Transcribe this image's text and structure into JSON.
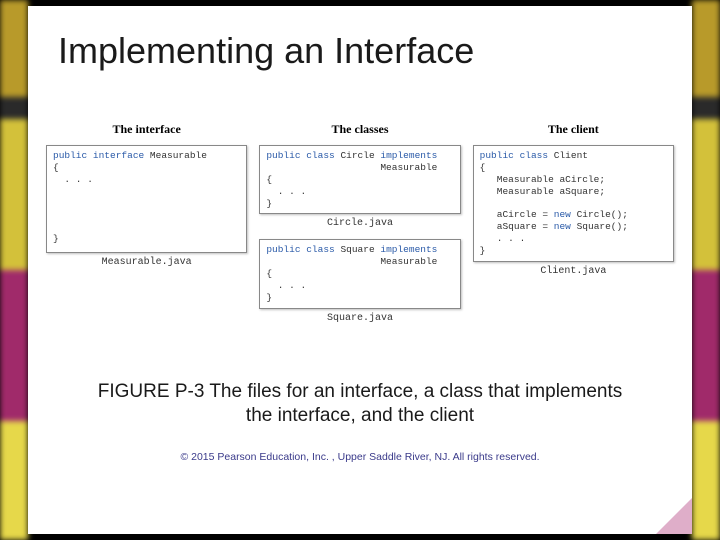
{
  "title": "Implementing an Interface",
  "columns": {
    "interface": {
      "header": "The interface",
      "box1": {
        "line1a": "public interface ",
        "line1b": "Measurable",
        "line2": "{",
        "line3": "  . . .",
        "blank": "",
        "lineEnd": "}"
      },
      "filename": "Measurable.java"
    },
    "classes": {
      "header": "The classes",
      "circle": {
        "line1a": "public class ",
        "line1b": "Circle ",
        "line1c": "implements",
        "line2": "                    Measurable",
        "line3": "{",
        "line4": "  . . .",
        "line5": "}"
      },
      "circle_filename": "Circle.java",
      "square": {
        "line1a": "public class ",
        "line1b": "Square ",
        "line1c": "implements",
        "line2": "                    Measurable",
        "line3": "{",
        "line4": "  . . .",
        "line5": "}"
      },
      "square_filename": "Square.java"
    },
    "client": {
      "header": "The client",
      "box": {
        "l1a": "public class ",
        "l1b": "Client",
        "l2": "{",
        "l3": "   Measurable aCircle;",
        "l4": "   Measurable aSquare;",
        "blank": "",
        "l5a": "   aCircle = ",
        "l5b": "new ",
        "l5c": "Circle();",
        "l6a": "   aSquare = ",
        "l6b": "new ",
        "l6c": "Square();",
        "l7": "   . . .",
        "l8": "}"
      },
      "filename": "Client.java"
    }
  },
  "caption": "FIGURE P-3  The files for an interface, a class that implements the interface, and the client",
  "copyright": "© 2015 Pearson Education, Inc. , Upper Saddle River, NJ.  All rights reserved."
}
